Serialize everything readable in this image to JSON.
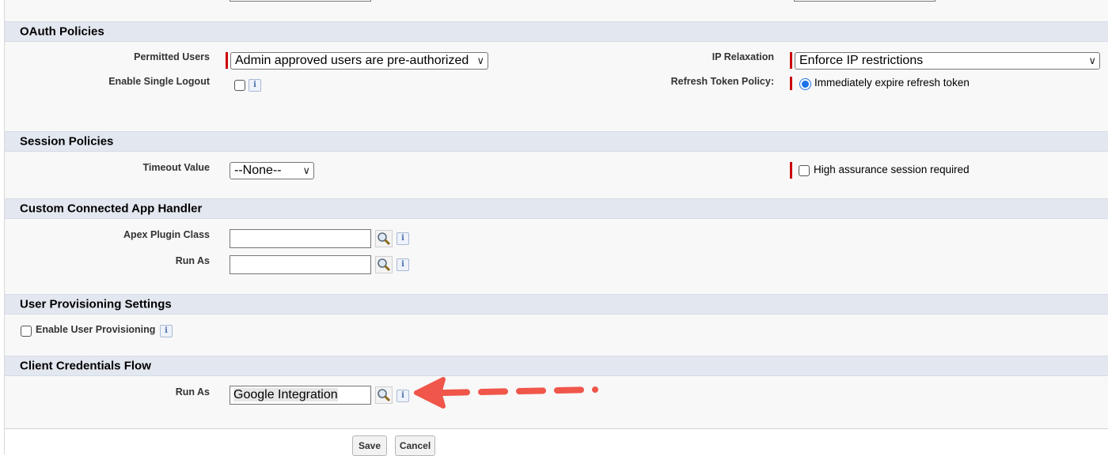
{
  "sections": {
    "oauth": {
      "title": "OAuth Policies",
      "permitted_users_label": "Permitted Users",
      "permitted_users_value": "Admin approved users are pre-authorized",
      "enable_single_logout_label": "Enable Single Logout",
      "ip_relaxation_label": "IP Relaxation",
      "ip_relaxation_value": "Enforce IP restrictions",
      "refresh_token_label": "Refresh Token Policy:",
      "refresh_token_option": "Immediately expire refresh token"
    },
    "session": {
      "title": "Session Policies",
      "timeout_label": "Timeout Value",
      "timeout_value": "--None--",
      "high_assurance_label": "High assurance session required"
    },
    "handler": {
      "title": "Custom Connected App Handler",
      "apex_plugin_label": "Apex Plugin Class",
      "apex_plugin_value": "",
      "run_as_label": "Run As",
      "run_as_value": ""
    },
    "provisioning": {
      "title": "User Provisioning Settings",
      "enable_label": "Enable User Provisioning"
    },
    "client_credentials": {
      "title": "Client Credentials Flow",
      "run_as_label": "Run As",
      "run_as_value": "Google Integration"
    }
  },
  "buttons": {
    "save": "Save",
    "cancel": "Cancel"
  },
  "icons": {
    "info": "i",
    "lookup": "magnifier-lookup-icon",
    "chevron": "∨"
  },
  "colors": {
    "required": "#cc0000",
    "header_bg": "#e3e7ef",
    "arrow": "#f0564a"
  }
}
